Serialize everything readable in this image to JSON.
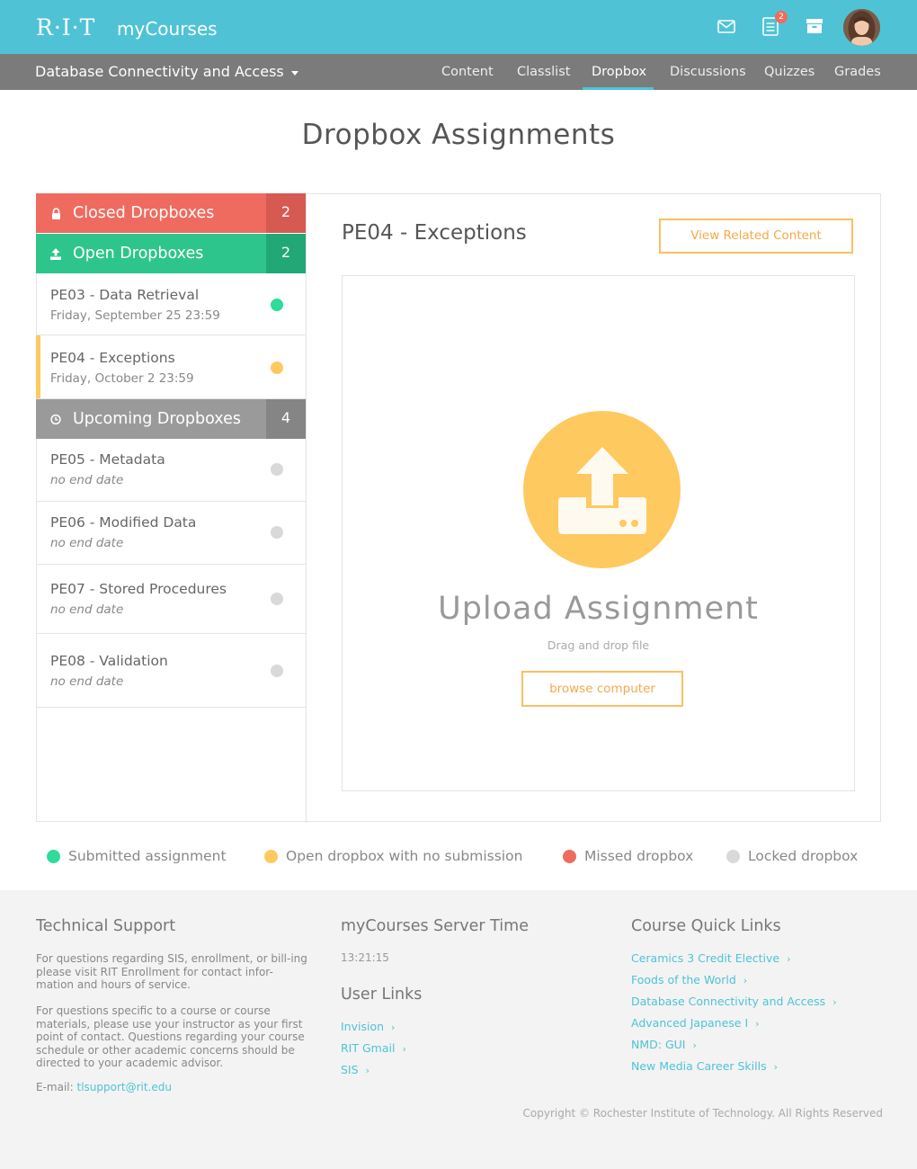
{
  "header": {
    "logo": "R·I·T",
    "app_name": "myCourses",
    "notification_count": "2"
  },
  "course_nav": {
    "course_name": "Database Connectivity and Access",
    "tabs": [
      {
        "label": "Content"
      },
      {
        "label": "Classlist"
      },
      {
        "label": "Dropbox",
        "active": true
      },
      {
        "label": "Discussions"
      },
      {
        "label": "Quizzes"
      },
      {
        "label": "Grades"
      }
    ]
  },
  "page_title": "Dropbox Assignments",
  "sidebar": {
    "closed": {
      "label": "Closed Dropboxes",
      "count": "2",
      "color": "#ef6b5f",
      "count_color": "#d75a52"
    },
    "open": {
      "label": "Open Dropboxes",
      "count": "2",
      "color": "#2ec58c",
      "count_color": "#22a877"
    },
    "upcoming": {
      "label": "Upcoming Dropboxes",
      "count": "4",
      "color": "#9a9a9a",
      "count_color": "#858585"
    },
    "open_items": [
      {
        "name": "PE03 - Data Retrieval",
        "date": "Friday, September 25 23:59",
        "status": "submitted"
      },
      {
        "name": "PE04 - Exceptions",
        "date": "Friday, October 2 23:59",
        "status": "open"
      }
    ],
    "upcoming_items": [
      {
        "name": "PE05 - Metadata",
        "date": "no end date",
        "status": "locked"
      },
      {
        "name": "PE06 - Modified Data",
        "date": "no end date",
        "status": "locked"
      },
      {
        "name": "PE07 - Stored Procedures",
        "date": "no end date",
        "status": "locked"
      },
      {
        "name": "PE08 - Validation",
        "date": "no end date",
        "status": "locked"
      }
    ]
  },
  "main": {
    "assignment_title": "PE04 - Exceptions",
    "related_button": "View Related Content",
    "upload_title": "Upload Assignment",
    "upload_hint": "Drag and drop file",
    "browse_button": "browse computer"
  },
  "legend": [
    {
      "label": "Submitted assignment",
      "color": "#2edc9a"
    },
    {
      "label": "Open dropbox with no submission",
      "color": "#fec95e"
    },
    {
      "label": "Missed dropbox",
      "color": "#ef6b5f"
    },
    {
      "label": "Locked dropbox",
      "color": "#d9d9d9"
    }
  ],
  "footer": {
    "support": {
      "heading": "Technical Support",
      "para1": "For questions regarding SIS, enrollment, or bill-ing please visit RIT Enrollment for contact infor-mation and hours of service.",
      "para2": "For questions specific to a course or course materials, please use your instructor as your first point of contact. Questions regarding your course schedule or other academic concerns should be directed to your academic advisor.",
      "email_label": "E-mail:",
      "email": "tlsupport@rit.edu"
    },
    "server_time": {
      "heading": "myCourses Server Time",
      "time": "13:21:15"
    },
    "user_links": {
      "heading": "User Links",
      "links": [
        "Invision",
        "RIT Gmail",
        "SIS"
      ]
    },
    "quick_links": {
      "heading": "Course Quick Links",
      "links": [
        "Ceramics 3 Credit Elective",
        "Foods of the World",
        "Database Connectivity and Access",
        "Advanced Japanese I",
        "NMD: GUI",
        "New Media Career Skills"
      ]
    },
    "copyright": "Copyright © Rochester Institute of Technology. All Rights Reserved"
  }
}
